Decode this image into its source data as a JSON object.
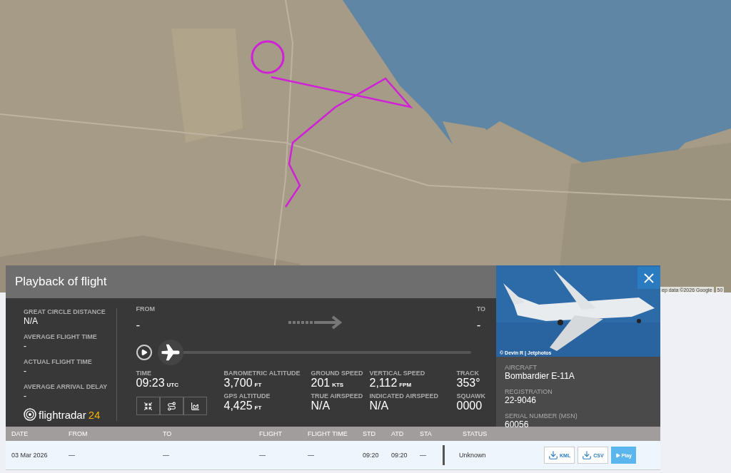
{
  "map": {
    "attribution": "ep data ©2026 Google",
    "scale": "50"
  },
  "panel": {
    "title": "Playback of flight",
    "stats": [
      {
        "label": "GREAT CIRCLE DISTANCE",
        "value": "N/A"
      },
      {
        "label": "AVERAGE FLIGHT TIME",
        "value": "-"
      },
      {
        "label": "ACTUAL FLIGHT TIME",
        "value": "-"
      },
      {
        "label": "AVERAGE ARRIVAL DELAY",
        "value": "-"
      }
    ],
    "logo": {
      "text": "flightradar",
      "accent": "24"
    },
    "from": {
      "label": "FROM",
      "value": "-"
    },
    "to": {
      "label": "TO",
      "value": "-"
    },
    "playback": {
      "level": 0.0
    },
    "readouts": [
      [
        {
          "label": "TIME",
          "value": "09:23",
          "unit": "UTC"
        }
      ],
      [
        {
          "label": "BAROMETRIC ALTITUDE",
          "value": "3,700",
          "unit": "FT"
        },
        {
          "label": "GPS ALTITUDE",
          "value": "4,425",
          "unit": "FT"
        }
      ],
      [
        {
          "label": "GROUND SPEED",
          "value": "201",
          "unit": "KTS"
        },
        {
          "label": "TRUE AIRSPEED",
          "value": "N/A"
        }
      ],
      [
        {
          "label": "VERTICAL SPEED",
          "value": "2,112",
          "unit": "FPM"
        },
        {
          "label": "INDICATED AIRSPEED",
          "value": "N/A"
        }
      ],
      [
        {
          "label": "TRACK",
          "value": "353°"
        },
        {
          "label": "SQUAWK",
          "value": "0000"
        }
      ]
    ],
    "photo": {
      "credit": "© Devin R | Jetphotos"
    },
    "aircraft": [
      {
        "label": "AIRCRAFT",
        "value": "Bombardier E-11A"
      },
      {
        "label": "REGISTRATION",
        "value": "22-9046"
      },
      {
        "label": "SERIAL NUMBER (MSN)",
        "value": "60056"
      }
    ]
  },
  "table": {
    "columns": [
      "DATE",
      "FROM",
      "TO",
      "FLIGHT",
      "FLIGHT TIME",
      "STD",
      "ATD",
      "STA",
      "STATUS"
    ],
    "rows": [
      {
        "selected": true,
        "cells": [
          "03 Mar 2026",
          "—",
          "—",
          "—",
          "—",
          "09:20",
          "09:20",
          "—",
          "Unknown"
        ],
        "actions": [
          {
            "kind": "download",
            "label": "KML"
          },
          {
            "kind": "download",
            "label": "CSV"
          },
          {
            "kind": "play",
            "label": "Play"
          }
        ]
      }
    ]
  }
}
